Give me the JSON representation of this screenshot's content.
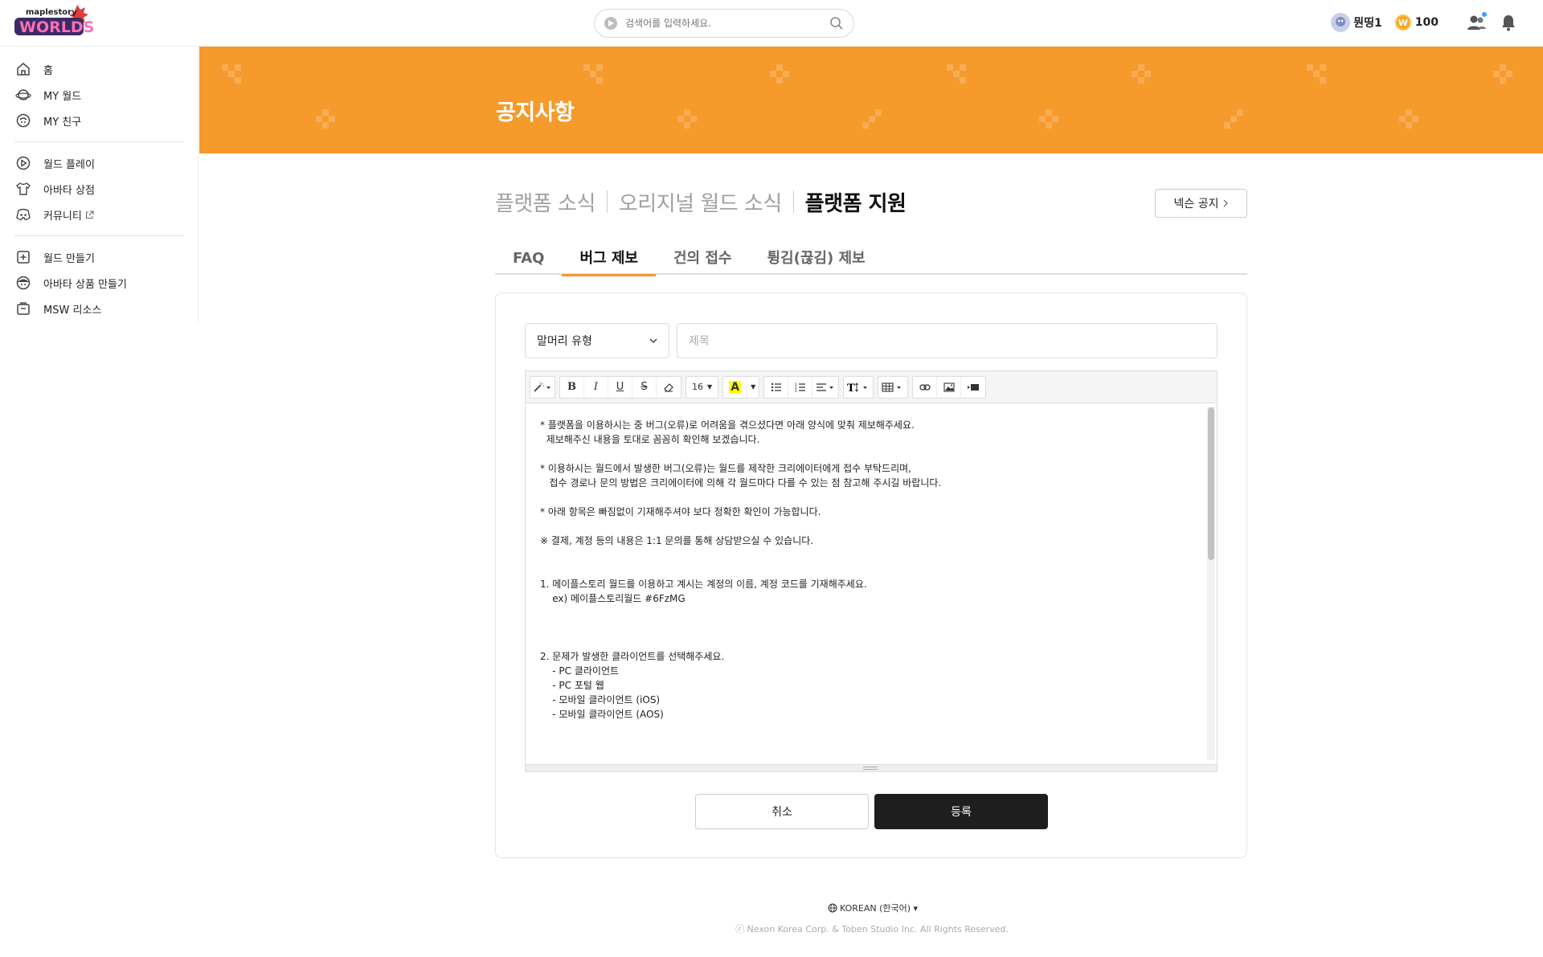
{
  "header": {
    "logo_text": "maplestory WORLDS",
    "search_placeholder": "검색어를 입력하세요.",
    "username": "뭔띵1",
    "coin_symbol": "W",
    "coins": "100"
  },
  "sidebar": {
    "groups": [
      [
        {
          "label": "홈",
          "icon": "home-icon"
        },
        {
          "label": "MY 월드",
          "icon": "planet-icon"
        },
        {
          "label": "MY 친구",
          "icon": "friend-icon"
        }
      ],
      [
        {
          "label": "월드 플레이",
          "icon": "play-icon"
        },
        {
          "label": "아바타 상점",
          "icon": "shirt-icon"
        },
        {
          "label": "커뮤니티",
          "icon": "discord-icon"
        }
      ],
      [
        {
          "label": "월드 만들기",
          "icon": "plus-square-icon"
        },
        {
          "label": "아바타 상품 만들기",
          "icon": "avatar-face-icon"
        },
        {
          "label": "MSW 리소스",
          "icon": "resource-box-icon"
        }
      ]
    ]
  },
  "banner": {
    "title": "공지사항",
    "color": "#f59a2b"
  },
  "categories": [
    "플랫폼 소식",
    "오리지널 월드 소식",
    "플랫폼 지원"
  ],
  "nexon_notice_label": "넥슨 공지",
  "tabs": [
    "FAQ",
    "버그 제보",
    "건의 접수",
    "튕김(끊김) 제보"
  ],
  "form": {
    "type_select": "말머리 유형",
    "title_placeholder": "제목",
    "font_size": "16",
    "body_lines": [
      "* 플랫폼을 이용하시는 중 버그(오류)로 어려움을 겪으셨다면 아래 양식에 맞춰 제보해주세요.",
      "  제보해주신 내용을 토대로 꼼꼼히 확인해 보겠습니다.",
      "",
      "* 이용하시는 월드에서 발생한 버그(오류)는 월드를 제작한 크리에이터에게 접수 부탁드리며,",
      "   접수 경로나 문의 방법은 크리에이터에 의해 각 월드마다 다를 수 있는 점 참고해 주시길 바랍니다.",
      "",
      "* 아래 항목은 빠짐없이 기재해주셔야 보다 정확한 확인이 가능합니다.",
      "",
      "※ 결제, 계정 등의 내용은 1:1 문의를 통해 상담받으실 수 있습니다.",
      "",
      "",
      "1. 메이플스토리 월드를 이용하고 계시는 계정의 이름, 계정 코드를 기재해주세요.",
      "    ex) 메이플스토리월드 #6FzMG",
      "",
      "",
      "",
      "2. 문제가 발생한 클라이언트를 선택해주세요.",
      "    - PC 클라이언트",
      "    - PC 포털 웹",
      "    - 모바일 클라이언트 (iOS)",
      "    - 모바일 클라이언트 (AOS)"
    ],
    "cancel_label": "취소",
    "submit_label": "등록"
  },
  "footer": {
    "language": "KOREAN (한국어) ▾",
    "copyright": "ⓒ Nexon Korea Corp. & Toben Studio Inc. All Rights Reserved."
  }
}
